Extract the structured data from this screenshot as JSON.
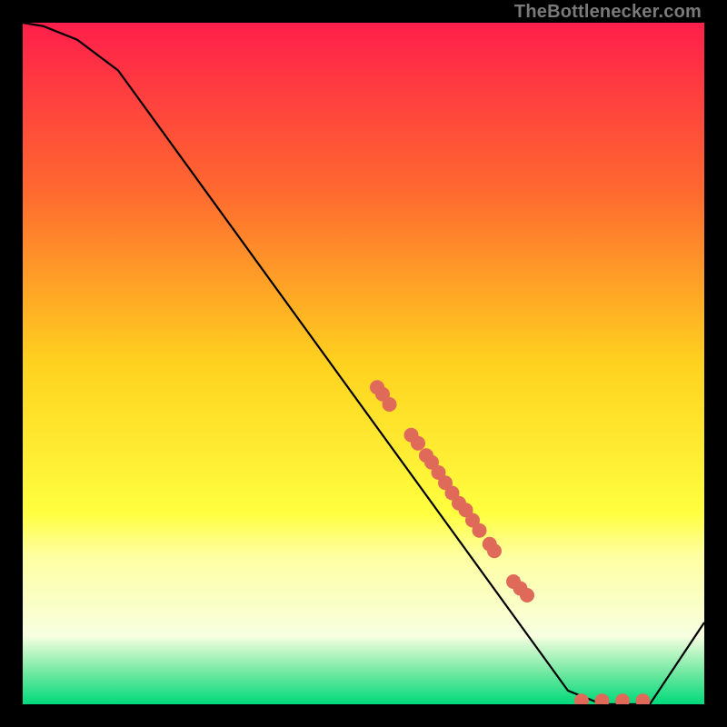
{
  "watermark": "TheBottlenecker.com",
  "chart_data": {
    "type": "line",
    "title": "",
    "xlabel": "",
    "ylabel": "",
    "xlim": [
      0,
      100
    ],
    "ylim": [
      0,
      100
    ],
    "grid": false,
    "background_gradient": {
      "type": "vertical",
      "stops": [
        {
          "pos": 0.0,
          "color": "#ff1f4b"
        },
        {
          "pos": 0.25,
          "color": "#ff6a2f"
        },
        {
          "pos": 0.5,
          "color": "#ffd21f"
        },
        {
          "pos": 0.72,
          "color": "#ffff40"
        },
        {
          "pos": 0.78,
          "color": "#ffffa0"
        },
        {
          "pos": 0.9,
          "color": "#f7ffe0"
        },
        {
          "pos": 0.955,
          "color": "#6de8a0"
        },
        {
          "pos": 1.0,
          "color": "#00d97a"
        }
      ]
    },
    "series": [
      {
        "name": "bottleneck-curve",
        "color": "#000000",
        "x": [
          0,
          3,
          8,
          14,
          80,
          85,
          92,
          100
        ],
        "y": [
          100,
          99.5,
          97.5,
          93,
          2,
          0,
          0,
          12
        ]
      }
    ],
    "markers": {
      "name": "sample-points",
      "color": "#e06a5a",
      "radius_px": 8,
      "points": [
        {
          "x": 52.0,
          "y": 46.5
        },
        {
          "x": 52.8,
          "y": 45.5
        },
        {
          "x": 53.8,
          "y": 44.0
        },
        {
          "x": 57.0,
          "y": 39.5
        },
        {
          "x": 58.0,
          "y": 38.3
        },
        {
          "x": 59.2,
          "y": 36.5
        },
        {
          "x": 60.0,
          "y": 35.5
        },
        {
          "x": 61.0,
          "y": 34.0
        },
        {
          "x": 62.0,
          "y": 32.5
        },
        {
          "x": 63.0,
          "y": 31.0
        },
        {
          "x": 64.0,
          "y": 29.5
        },
        {
          "x": 65.0,
          "y": 28.5
        },
        {
          "x": 66.0,
          "y": 27.0
        },
        {
          "x": 67.0,
          "y": 25.5
        },
        {
          "x": 68.5,
          "y": 23.5
        },
        {
          "x": 69.2,
          "y": 22.5
        },
        {
          "x": 72.0,
          "y": 18.0
        },
        {
          "x": 73.0,
          "y": 17.0
        },
        {
          "x": 74.0,
          "y": 16.0
        },
        {
          "x": 82.0,
          "y": 0.5
        },
        {
          "x": 85.0,
          "y": 0.5
        },
        {
          "x": 88.0,
          "y": 0.5
        },
        {
          "x": 91.0,
          "y": 0.5
        }
      ]
    }
  }
}
